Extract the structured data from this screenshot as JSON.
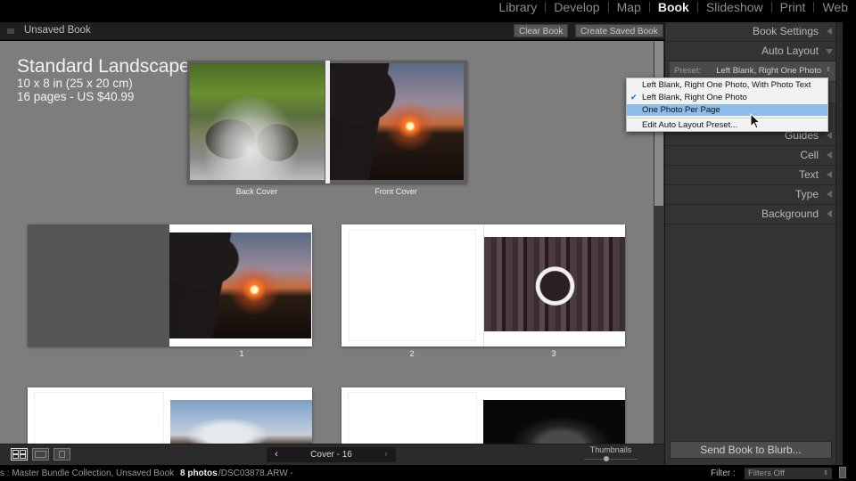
{
  "modules": [
    {
      "label": "Library",
      "active": false
    },
    {
      "label": "Develop",
      "active": false
    },
    {
      "label": "Map",
      "active": false
    },
    {
      "label": "Book",
      "active": true
    },
    {
      "label": "Slideshow",
      "active": false
    },
    {
      "label": "Print",
      "active": false
    },
    {
      "label": "Web",
      "active": false
    }
  ],
  "header": {
    "title": "Unsaved Book",
    "clear_book": "Clear Book",
    "create_saved_book": "Create Saved Book"
  },
  "book": {
    "name": "Standard Landscape",
    "size": "10 x 8 in (25 x 20 cm)",
    "pages_price": "16 pages - US $40.99",
    "cover": {
      "back_label": "Back Cover",
      "front_label": "Front Cover"
    },
    "spreads": [
      {
        "left_label": "",
        "right_label": "1"
      },
      {
        "left_label": "2",
        "right_label": "3"
      }
    ]
  },
  "toolbar": {
    "page_range": "Cover - 16",
    "thumbnails_label": "Thumbnails",
    "prev_icon": "‹",
    "next_icon": "›"
  },
  "right_panel": {
    "sections": [
      "Book Settings",
      "Auto Layout",
      "Guides",
      "Cell",
      "Text",
      "Type",
      "Background"
    ],
    "preset_label": "Preset:",
    "preset_value": "Left Blank, Right One Photo",
    "send_button": "Send Book to Blurb..."
  },
  "dropdown": {
    "items": [
      {
        "label": "Left Blank, Right One Photo, With Photo Text",
        "checked": false,
        "highlighted": false
      },
      {
        "label": "Left Blank, Right One Photo",
        "checked": true,
        "highlighted": false
      },
      {
        "label": "One Photo Per Page",
        "checked": false,
        "highlighted": true
      }
    ],
    "edit_item": "Edit Auto Layout Preset...",
    "check_glyph": "✔"
  },
  "status": {
    "source": "s : Master Bundle Collection, Unsaved Book",
    "count": "8 photos",
    "file": "/DSC03878.ARW -",
    "filter_label": "Filter :",
    "filter_value": "Filters Off"
  }
}
